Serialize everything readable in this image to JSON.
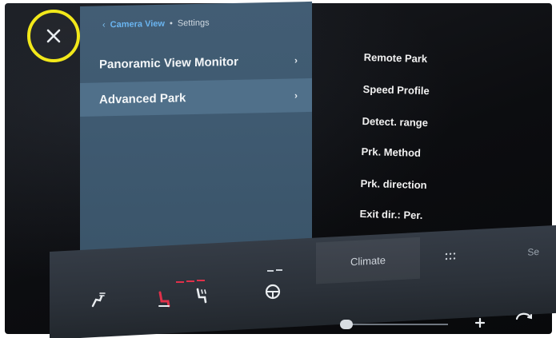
{
  "close": {
    "icon": "close-icon"
  },
  "breadcrumb": {
    "back_icon": "chevron-left-icon",
    "parent": "Camera View",
    "separator": "•",
    "current": "Settings"
  },
  "menu": {
    "items": [
      {
        "label": "Panoramic View Monitor",
        "arrow_icon": "chevron-right-icon",
        "selected": false
      },
      {
        "label": "Advanced Park",
        "arrow_icon": "chevron-right-icon",
        "selected": true
      }
    ]
  },
  "advanced_park_options": [
    "Remote Park",
    "Speed Profile",
    "Detect. range",
    "Prk. Method",
    "Prk. direction",
    "Exit dir.: Per."
  ],
  "bottom_bar": {
    "climate_label": "Climate",
    "more_label": "Se",
    "icons": [
      "seat-airflow-icon",
      "heated-seat-left-icon",
      "heated-seat-right-icon",
      "steering-heat-icon",
      "apps-grid-icon",
      "plus-icon",
      "recirculation-icon"
    ]
  },
  "colors": {
    "highlight_ring": "#f2e81a",
    "panel": "#425d74",
    "selected_row": "#50708a",
    "link": "#6ab4f0",
    "heat_indicator": "#e0304a"
  }
}
